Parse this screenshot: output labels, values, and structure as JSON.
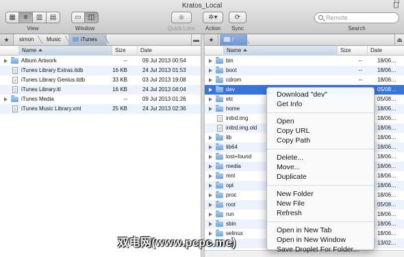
{
  "window": {
    "title": "Kratos_Local"
  },
  "toolbar": {
    "view_label": "View",
    "window_label": "Window",
    "quicklook_label": "Quick Look",
    "action_label": "Action",
    "sync_label": "Sync",
    "search_label": "Search",
    "search_placeholder": "Remote"
  },
  "left_pane": {
    "breadcrumb": [
      "simon",
      "Music",
      "iTunes"
    ],
    "columns": {
      "name": "Name",
      "size": "Size",
      "date": "Date"
    },
    "rows": [
      {
        "name": "Album Artwork",
        "size": "--",
        "date": "09 Jul 2013 00:54",
        "kind": "folder"
      },
      {
        "name": "iTunes Library Extras.itdb",
        "size": "16 KB",
        "date": "24 Jul 2013 01:53",
        "kind": "doc"
      },
      {
        "name": "iTunes Library Genius.itdb",
        "size": "33 KB",
        "date": "03 Jul 2013 19:08",
        "kind": "doc"
      },
      {
        "name": "iTunes Library.itl",
        "size": "16 KB",
        "date": "24 Jul 2013 04:04",
        "kind": "doc"
      },
      {
        "name": "iTunes Media",
        "size": "--",
        "date": "09 Jul 2013 01:26",
        "kind": "folder"
      },
      {
        "name": "iTunes Music Library.xml",
        "size": "25 KB",
        "date": "24 Jul 2013 02:36",
        "kind": "doc"
      }
    ]
  },
  "right_pane": {
    "breadcrumb": [
      "/"
    ],
    "columns": {
      "name": "Name",
      "size": "Size",
      "date": "Date"
    },
    "rows": [
      {
        "name": "bin",
        "size": "--",
        "date": "18/06…",
        "kind": "folder"
      },
      {
        "name": "boot",
        "size": "--",
        "date": "18/06…",
        "kind": "folder"
      },
      {
        "name": "cdrom",
        "size": "--",
        "date": "18/06…",
        "kind": "folder"
      },
      {
        "name": "dev",
        "size": "",
        "date": "05/08…",
        "kind": "folder"
      },
      {
        "name": "etc",
        "size": "",
        "date": "05/08…",
        "kind": "folder"
      },
      {
        "name": "home",
        "size": "",
        "date": "18/06…",
        "kind": "folder"
      },
      {
        "name": "initrd.img",
        "size": "",
        "date": "18/06…",
        "kind": "doc"
      },
      {
        "name": "initrd.img.old",
        "size": "",
        "date": "18/06…",
        "kind": "doc"
      },
      {
        "name": "lib",
        "size": "",
        "date": "18/06…",
        "kind": "folder"
      },
      {
        "name": "lib64",
        "size": "",
        "date": "18/06…",
        "kind": "folder"
      },
      {
        "name": "lost+found",
        "size": "",
        "date": "18/06…",
        "kind": "folder"
      },
      {
        "name": "media",
        "size": "",
        "date": "18/06…",
        "kind": "folder"
      },
      {
        "name": "mnt",
        "size": "",
        "date": "18/06…",
        "kind": "folder"
      },
      {
        "name": "opt",
        "size": "",
        "date": "18/06…",
        "kind": "folder"
      },
      {
        "name": "proc",
        "size": "",
        "date": "18/06…",
        "kind": "folder"
      },
      {
        "name": "root",
        "size": "",
        "date": "05/08…",
        "kind": "folder"
      },
      {
        "name": "run",
        "size": "",
        "date": "18/06…",
        "kind": "folder"
      },
      {
        "name": "sbin",
        "size": "",
        "date": "18/06…",
        "kind": "folder"
      },
      {
        "name": "selinux",
        "size": "",
        "date": "18/06…",
        "kind": "folder"
      },
      {
        "name": "srv",
        "size": "",
        "date": "13/02…",
        "kind": "folder"
      }
    ]
  },
  "context_menu": {
    "groups": [
      [
        "Download \"dev\"",
        "Get Info"
      ],
      [
        "Open",
        "Copy URL",
        "Copy Path"
      ],
      [
        "Delete...",
        "Move...",
        "Duplicate"
      ],
      [
        "New Folder",
        "New File",
        "Refresh"
      ],
      [
        "Open in New Tab",
        "Open in New Window",
        "Save Droplet For Folder..."
      ]
    ]
  },
  "watermark": "双电网(www.pcpc.me)",
  "colors": {
    "selection": "#3875d7",
    "stripe": "#edf3fe",
    "folder": "#6ea4dc"
  }
}
